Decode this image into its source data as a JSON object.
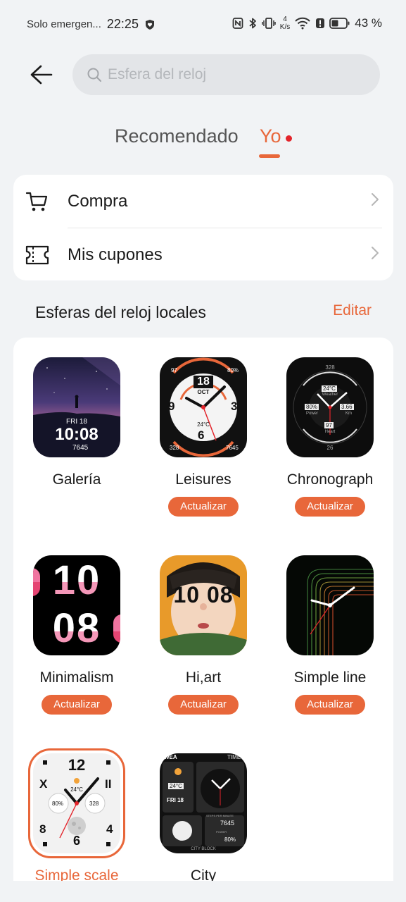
{
  "status": {
    "carrier": "Solo emergen...",
    "time": "22:25",
    "speed_value": "4",
    "speed_unit": "K/s",
    "battery": "43 %"
  },
  "search": {
    "placeholder": "Esfera del reloj"
  },
  "tabs": [
    {
      "label": "Recomendado",
      "active": false
    },
    {
      "label": "Yo",
      "active": true
    }
  ],
  "menu": [
    {
      "label": "Compra",
      "icon": "cart-icon"
    },
    {
      "label": "Mis cupones",
      "icon": "coupon-icon"
    }
  ],
  "section": {
    "title": "Esferas del reloj locales",
    "edit_label": "Editar"
  },
  "faces": [
    {
      "name": "Galería",
      "update": "",
      "thumb_day": "FRI 18",
      "thumb_time": "10:08",
      "thumb_steps": "7645"
    },
    {
      "name": "Leisures",
      "update": "Actualizar",
      "thumb_day": "18",
      "thumb_month": "OCT",
      "thumb_temp": "24°C",
      "thumb_pct": "80%",
      "thumb_97": "97",
      "thumb_328": "328",
      "thumb_steps": "7645"
    },
    {
      "name": "Chronograph",
      "update": "Actualizar",
      "thumb_temp": "24°C",
      "thumb_weather": "Weather",
      "thumb_power": "80%",
      "thumb_power_lbl": "Power",
      "thumb_km": "3.66",
      "thumb_km_lbl": "Km",
      "thumb_heart": "97",
      "thumb_heart_lbl": "Heart",
      "thumb_328": "328",
      "thumb_26": "26"
    },
    {
      "name": "Minimalism",
      "update": "Actualizar",
      "thumb_hour": "10",
      "thumb_min": "08"
    },
    {
      "name": "Hi,art",
      "update": "Actualizar",
      "thumb_hour": "10",
      "thumb_min": "08"
    },
    {
      "name": "Simple line",
      "update": "Actualizar"
    },
    {
      "name": "Simple scale",
      "update": "",
      "selected": true,
      "thumb_temp": "24°C",
      "thumb_pct": "80%",
      "thumb_328": "328"
    },
    {
      "name": "City",
      "update": "",
      "thumb_wea": "WEA",
      "thumb_time_lbl": "TIME",
      "thumb_temp": "24°C",
      "thumb_date": "FRI 18",
      "thumb_steps_lbl": "STEPS PER MINUTE",
      "thumb_steps": "7645",
      "thumb_power": "80%",
      "thumb_power_lbl": "POWER",
      "thumb_city": "CITY BLOCK"
    }
  ],
  "colors": {
    "accent": "#e8673a",
    "background": "#f1f3f5",
    "card": "#ffffff",
    "dot": "#e3242b"
  }
}
